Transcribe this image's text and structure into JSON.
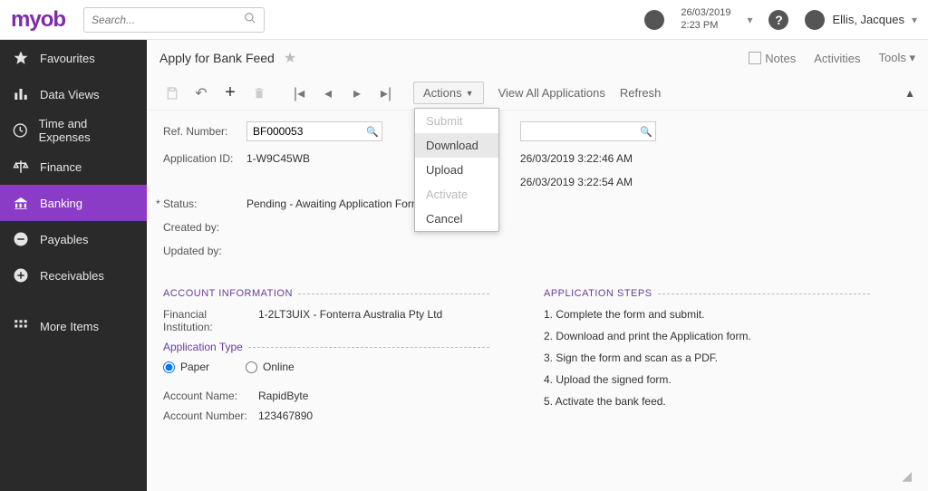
{
  "logo": "myob",
  "search": {
    "placeholder": "Search..."
  },
  "header": {
    "date": "26/03/2019",
    "time": "2:23 PM",
    "user": "Ellis, Jacques"
  },
  "sidebar": {
    "items": [
      {
        "label": "Favourites"
      },
      {
        "label": "Data Views"
      },
      {
        "label": "Time and Expenses"
      },
      {
        "label": "Finance"
      },
      {
        "label": "Banking"
      },
      {
        "label": "Payables"
      },
      {
        "label": "Receivables"
      }
    ],
    "more": "More Items"
  },
  "page": {
    "title": "Apply for Bank Feed",
    "header_actions": {
      "notes": "Notes",
      "activities": "Activities",
      "tools": "Tools"
    }
  },
  "toolbar": {
    "actions_label": "Actions",
    "view_all": "View All Applications",
    "refresh": "Refresh",
    "dropdown": {
      "submit": "Submit",
      "download": "Download",
      "upload": "Upload",
      "activate": "Activate",
      "cancel": "Cancel"
    }
  },
  "form": {
    "ref_number_label": "Ref. Number:",
    "ref_number": "BF000053",
    "application_id_label": "Application ID:",
    "application_id": "1-W9C45WB",
    "status_label": "Status:",
    "status": "Pending - Awaiting Application Form",
    "created_by_label": "Created by:",
    "updated_by_label": "Updated by:",
    "right_ts1": "26/03/2019 3:22:46 AM",
    "right_ts2": "26/03/2019 3:22:54 AM"
  },
  "account_info": {
    "header": "ACCOUNT INFORMATION",
    "fi_label": "Financial Institution:",
    "fi_value": "1-2LT3UIX - Fonterra Australia Pty Ltd",
    "app_type_label": "Application Type",
    "paper": "Paper",
    "online": "Online",
    "account_name_label": "Account Name:",
    "account_name": "RapidByte",
    "account_number_label": "Account Number:",
    "account_number": "123467890"
  },
  "steps": {
    "header": "APPLICATION STEPS",
    "s1": "1. Complete the form and submit.",
    "s2": "2. Download and print the Application form.",
    "s3": "3. Sign the form and scan as a PDF.",
    "s4": "4. Upload the signed form.",
    "s5": "5. Activate the bank feed."
  }
}
